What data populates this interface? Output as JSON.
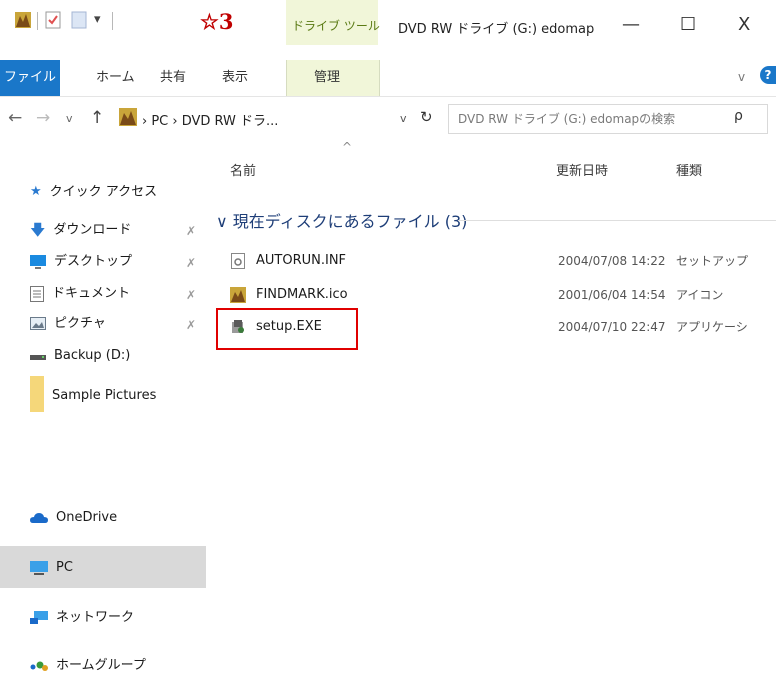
{
  "titlebar": {
    "star_label": "☆3",
    "drive_tools": "ドライブ ツール",
    "window_title": "DVD RW ドライブ (G:) edomap",
    "minimize_glyph": "—",
    "maximize_glyph": "☐",
    "close_glyph": "X"
  },
  "ribbon": {
    "tabs": [
      "ファイル",
      "ホーム",
      "共有",
      "表示",
      "管理"
    ],
    "expand_glyph": "v",
    "help_glyph": "?"
  },
  "address": {
    "back_glyph": "←",
    "forward_glyph": "→",
    "recent_glyph": "v",
    "up_glyph": "↑",
    "crumbs": "› PC › DVD RW ドラ...",
    "dropdown_glyph": "v",
    "refresh_glyph": "↻",
    "search_placeholder": "DVD RW ドライブ (G:) edomapの検索",
    "search_glyph": "ρ"
  },
  "sidebar": {
    "items": [
      {
        "label": "クイック アクセス",
        "icon": "star-icon"
      },
      {
        "label": "ダウンロード",
        "icon": "download-icon"
      },
      {
        "label": "デスクトップ",
        "icon": "desktop-icon"
      },
      {
        "label": "ドキュメント",
        "icon": "documents-icon"
      },
      {
        "label": "ピクチャ",
        "icon": "pictures-icon"
      },
      {
        "label": "Backup (D:)",
        "icon": "drive-icon"
      },
      {
        "label": "Sample Pictures",
        "icon": "folder-icon"
      },
      {
        "label": "OneDrive",
        "icon": "cloud-icon"
      },
      {
        "label": "PC",
        "icon": "pc-icon"
      },
      {
        "label": "ネットワーク",
        "icon": "network-icon"
      },
      {
        "label": "ホームグループ",
        "icon": "homegroup-icon"
      }
    ],
    "pin_glyph": "✗"
  },
  "content": {
    "columns": [
      "名前",
      "更新日時",
      "種類"
    ],
    "sort_glyph": "^",
    "group_header": "∨ 現在ディスクにあるファイル (3)",
    "files": [
      {
        "name": "AUTORUN.INF",
        "date": "2004/07/08 14:22",
        "type": "セットアップ",
        "icon": "settings-file-icon"
      },
      {
        "name": "FINDMARK.ico",
        "date": "2001/06/04 14:54",
        "type": "アイコン",
        "icon": "icon-file-icon"
      },
      {
        "name": "setup.EXE",
        "date": "2004/07/10 22:47",
        "type": "アプリケーシ",
        "icon": "setup-exe-icon"
      }
    ]
  },
  "colors": {
    "file_tab": "#1a77c9",
    "drive_tools_bg": "#f1f6d9",
    "highlight": "#e00000",
    "selected_row": "#d9d9d9",
    "star": "#c00000"
  }
}
